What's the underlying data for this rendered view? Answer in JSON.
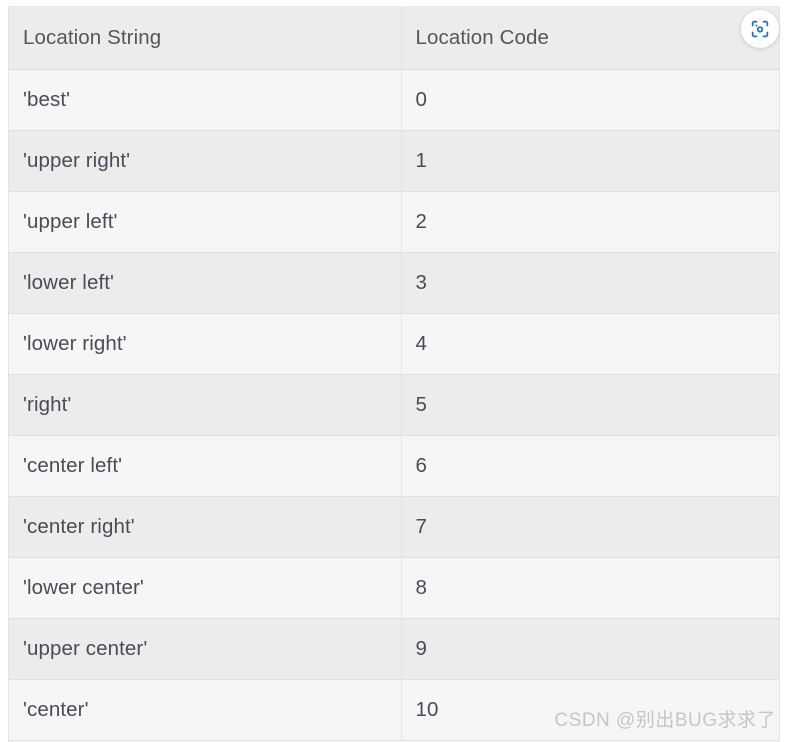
{
  "table": {
    "columns": [
      "Location String",
      "Location Code"
    ],
    "rows": [
      {
        "location_string": "'best'",
        "location_code": "0"
      },
      {
        "location_string": "'upper right'",
        "location_code": "1"
      },
      {
        "location_string": "'upper left'",
        "location_code": "2"
      },
      {
        "location_string": "'lower left'",
        "location_code": "3"
      },
      {
        "location_string": "'lower right'",
        "location_code": "4"
      },
      {
        "location_string": "'right'",
        "location_code": "5"
      },
      {
        "location_string": "'center left'",
        "location_code": "6"
      },
      {
        "location_string": "'center right'",
        "location_code": "7"
      },
      {
        "location_string": "'lower center'",
        "location_code": "8"
      },
      {
        "location_string": "'upper center'",
        "location_code": "9"
      },
      {
        "location_string": "'center'",
        "location_code": "10"
      }
    ]
  },
  "scan_button": {
    "icon": "scan-lens-icon",
    "accent_color": "#1a6fd4"
  },
  "watermark": {
    "text": "CSDN @别出BUG求求了",
    "color": "#c6c6ca"
  },
  "colors": {
    "header_bg": "#ececec",
    "row_odd_bg": "#f6f6f7",
    "row_even_bg": "#ececec",
    "header_text": "#56565e",
    "body_text": "#4b4b59",
    "border": "#e0e0e2"
  }
}
